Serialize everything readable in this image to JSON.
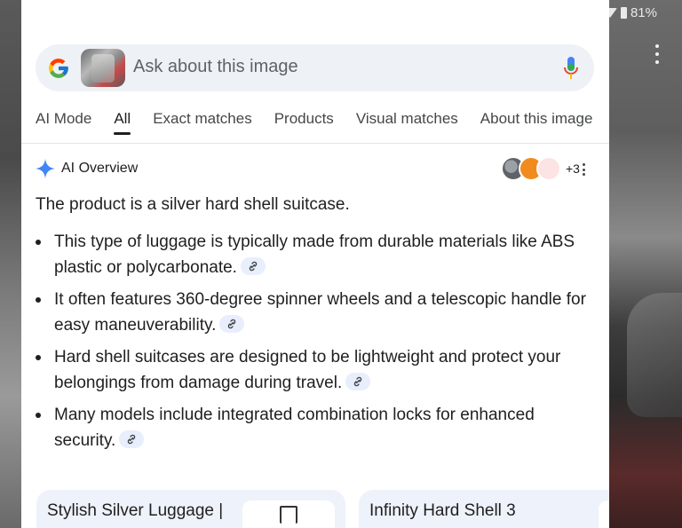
{
  "status_bar": {
    "battery": "81%"
  },
  "search": {
    "placeholder": "Ask about this image"
  },
  "tabs": [
    {
      "label": "AI Mode",
      "active": false
    },
    {
      "label": "All",
      "active": true
    },
    {
      "label": "Exact matches",
      "active": false
    },
    {
      "label": "Products",
      "active": false
    },
    {
      "label": "Visual matches",
      "active": false
    },
    {
      "label": "About this image",
      "active": false
    }
  ],
  "ai_overview": {
    "title": "AI Overview",
    "sources_more": "+3",
    "source_icons": [
      "source-1-icon",
      "source-2-icon",
      "source-3-icon"
    ],
    "summary": "The product is a silver hard shell suitcase.",
    "bullets": [
      "This type of luggage is typically made from durable materials like ABS plastic or polycarbonate.",
      "It often features 360-degree spinner wheels and a telescopic handle for easy maneuverability.",
      "Hard shell suitcases are designed to be lightweight and protect your belongings from damage during travel.",
      "Many models include integrated combination locks for enhanced security."
    ]
  },
  "cards": [
    {
      "title": "Stylish Silver Luggage |"
    },
    {
      "title": "Infinity Hard Shell 3"
    }
  ],
  "colors": {
    "accent": "#4285f4",
    "chip": "#e8eefc",
    "card": "#eef2fb"
  }
}
